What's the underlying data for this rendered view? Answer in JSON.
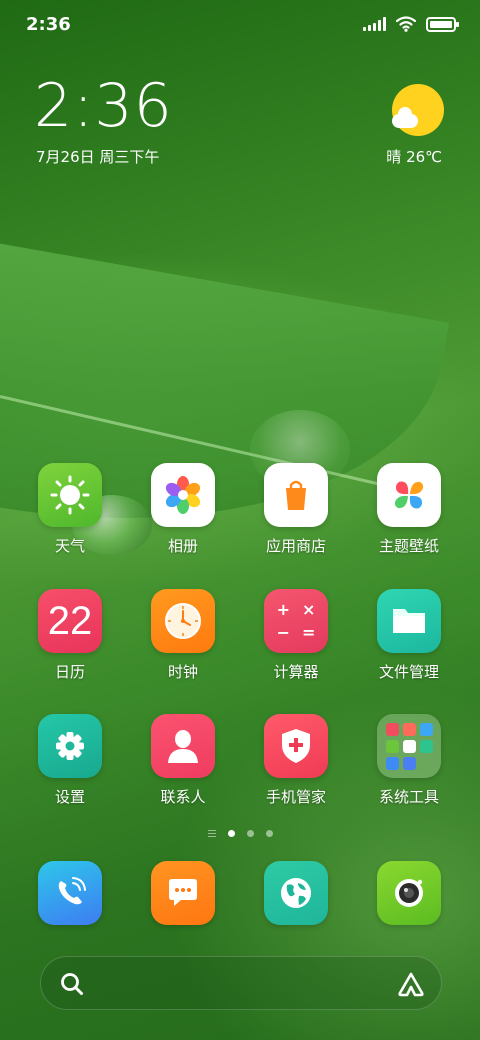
{
  "status_bar": {
    "time": "2:36",
    "icons": [
      "signal-icon",
      "wifi-icon",
      "battery-icon"
    ],
    "battery_level": 1.0
  },
  "clock_widget": {
    "time": "2:36",
    "date": "7月26日 周三下午"
  },
  "weather_widget": {
    "icon": "sun-cloud-icon",
    "text": "晴 26℃"
  },
  "apps": [
    {
      "label": "天气",
      "icon": "weather-icon"
    },
    {
      "label": "相册",
      "icon": "gallery-icon"
    },
    {
      "label": "应用商店",
      "icon": "app-store-icon"
    },
    {
      "label": "主题壁纸",
      "icon": "themes-icon"
    },
    {
      "label": "日历",
      "icon": "calendar-icon",
      "badge_text": "22"
    },
    {
      "label": "时钟",
      "icon": "clock-icon"
    },
    {
      "label": "计算器",
      "icon": "calculator-icon",
      "symbols": [
        "+",
        "×",
        "−",
        "="
      ]
    },
    {
      "label": "文件管理",
      "icon": "file-manager-icon"
    },
    {
      "label": "设置",
      "icon": "settings-icon"
    },
    {
      "label": "联系人",
      "icon": "contacts-icon"
    },
    {
      "label": "手机管家",
      "icon": "security-icon"
    },
    {
      "label": "系统工具",
      "icon": "folder-icon"
    }
  ],
  "page_indicator": {
    "pages": 3,
    "active": 0
  },
  "dock": [
    {
      "icon": "phone-icon"
    },
    {
      "icon": "messages-icon"
    },
    {
      "icon": "browser-icon"
    },
    {
      "icon": "camera-icon"
    }
  ],
  "search_bar": {
    "left_icon": "search-icon",
    "right_icon": "assistant-icon"
  },
  "colors": {
    "weather_sun": "#ffd21f",
    "wallpaper_green": "#3c8a28"
  }
}
